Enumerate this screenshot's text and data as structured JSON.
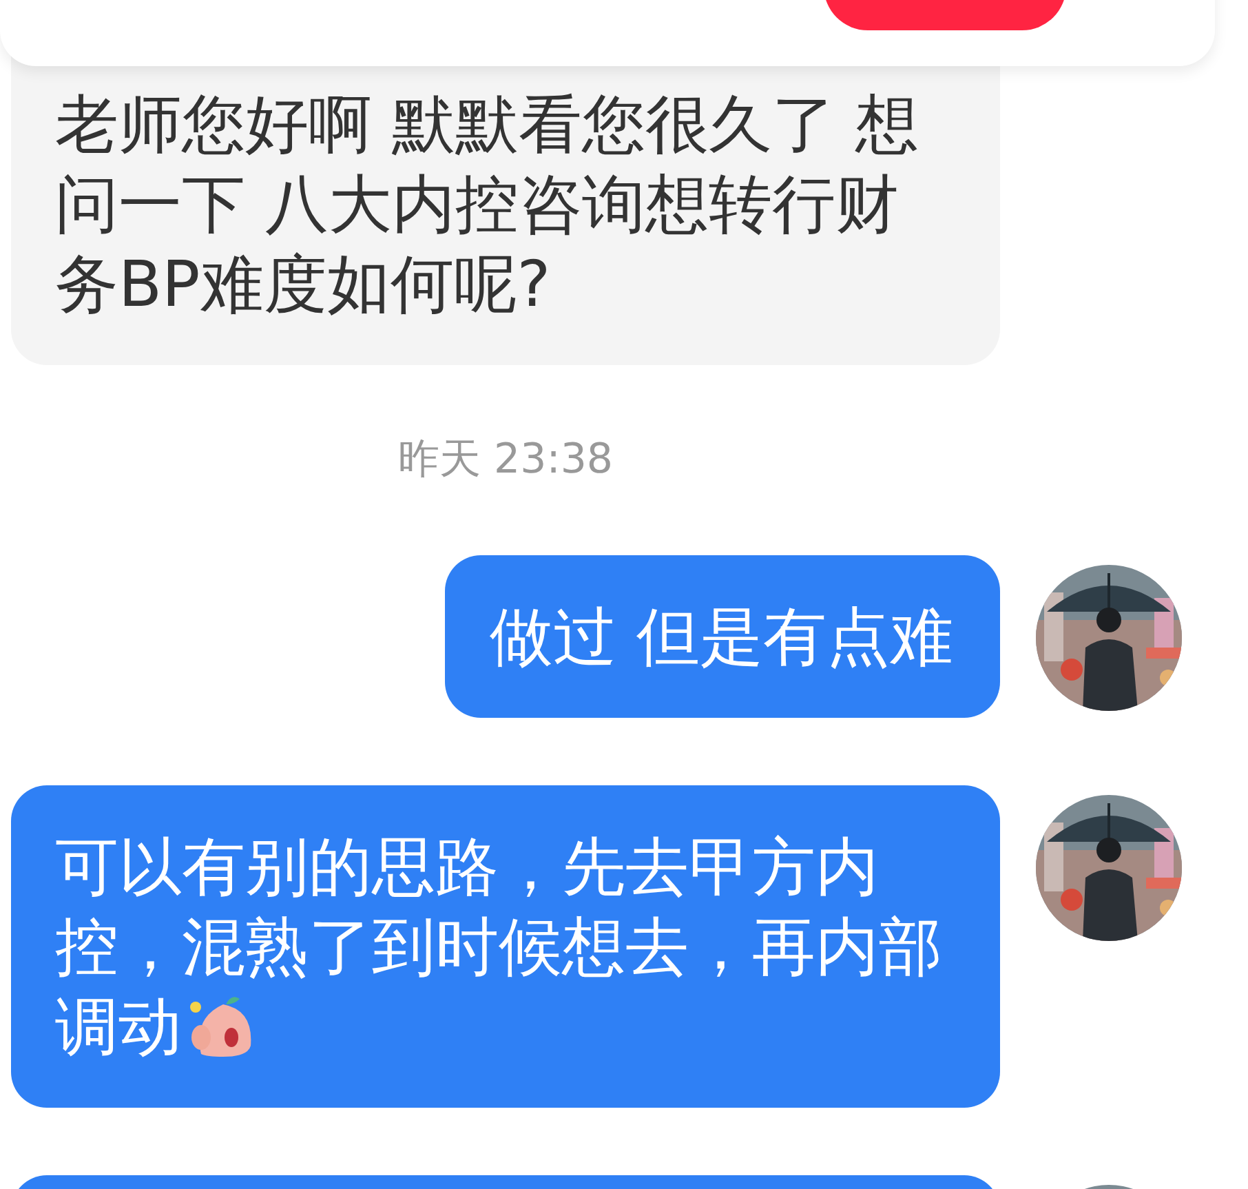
{
  "top_card": {
    "button": {
      "kind": "primary"
    }
  },
  "messages": [
    {
      "kind": "received",
      "text": "老师您好啊 默默看您很久了  想问一下 八大内控咨询想转行财务BP难度如何呢?"
    },
    {
      "kind": "time",
      "text": "昨天 23:38"
    },
    {
      "kind": "sent",
      "text": "做过 但是有点难"
    },
    {
      "kind": "sent",
      "text": "可以有别的思路，先去甲方内控，混熟了到时候想去，再内部调动",
      "sticker": true
    },
    {
      "kind": "sent"
    }
  ]
}
